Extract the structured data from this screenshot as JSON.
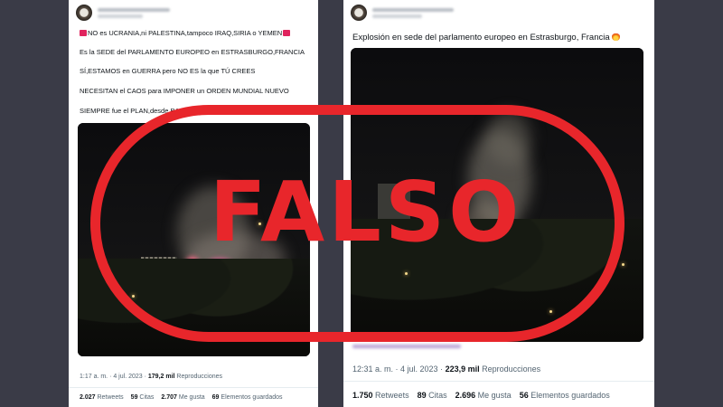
{
  "left_tweet": {
    "lines": [
      "NO es UCRANIA,ni PALESTINA,tampoco IRAQ,SIRIA o YEMEN",
      "Es la SEDE del PARLAMENTO EUROPEO en ESTRASBURGO,FRANCIA",
      "SÍ,ESTAMOS en GUERRA pero NO ES la que TÚ CREES",
      "NECESITAN el CAOS para IMPONER un ORDEN MUNDIAL NUEVO",
      "SIEMPRE fue el PLAN,desde BABILONIA"
    ],
    "timestamp": "1:17 a. m. · 4 jul. 2023 ·",
    "views": "179,2 mil",
    "views_label": "Reproducciones",
    "stats": [
      {
        "count": "2.027",
        "label": "Retweets"
      },
      {
        "count": "59",
        "label": "Citas"
      },
      {
        "count": "2.707",
        "label": "Me gusta"
      },
      {
        "count": "69",
        "label": "Elementos guardados"
      }
    ],
    "tag_color": "#e0245e"
  },
  "right_tweet": {
    "text": "Explosión en sede del parlamento europeo en Estrasburgo, Francia",
    "timestamp": "12:31 a. m. · 4 jul. 2023 ·",
    "views": "223,9 mil",
    "views_label": "Reproducciones",
    "stats": [
      {
        "count": "1.750",
        "label": "Retweets"
      },
      {
        "count": "89",
        "label": "Citas"
      },
      {
        "count": "2.696",
        "label": "Me gusta"
      },
      {
        "count": "56",
        "label": "Elementos guardados"
      }
    ]
  },
  "stamp": {
    "word": "FALSO",
    "color": "#e8262b"
  }
}
